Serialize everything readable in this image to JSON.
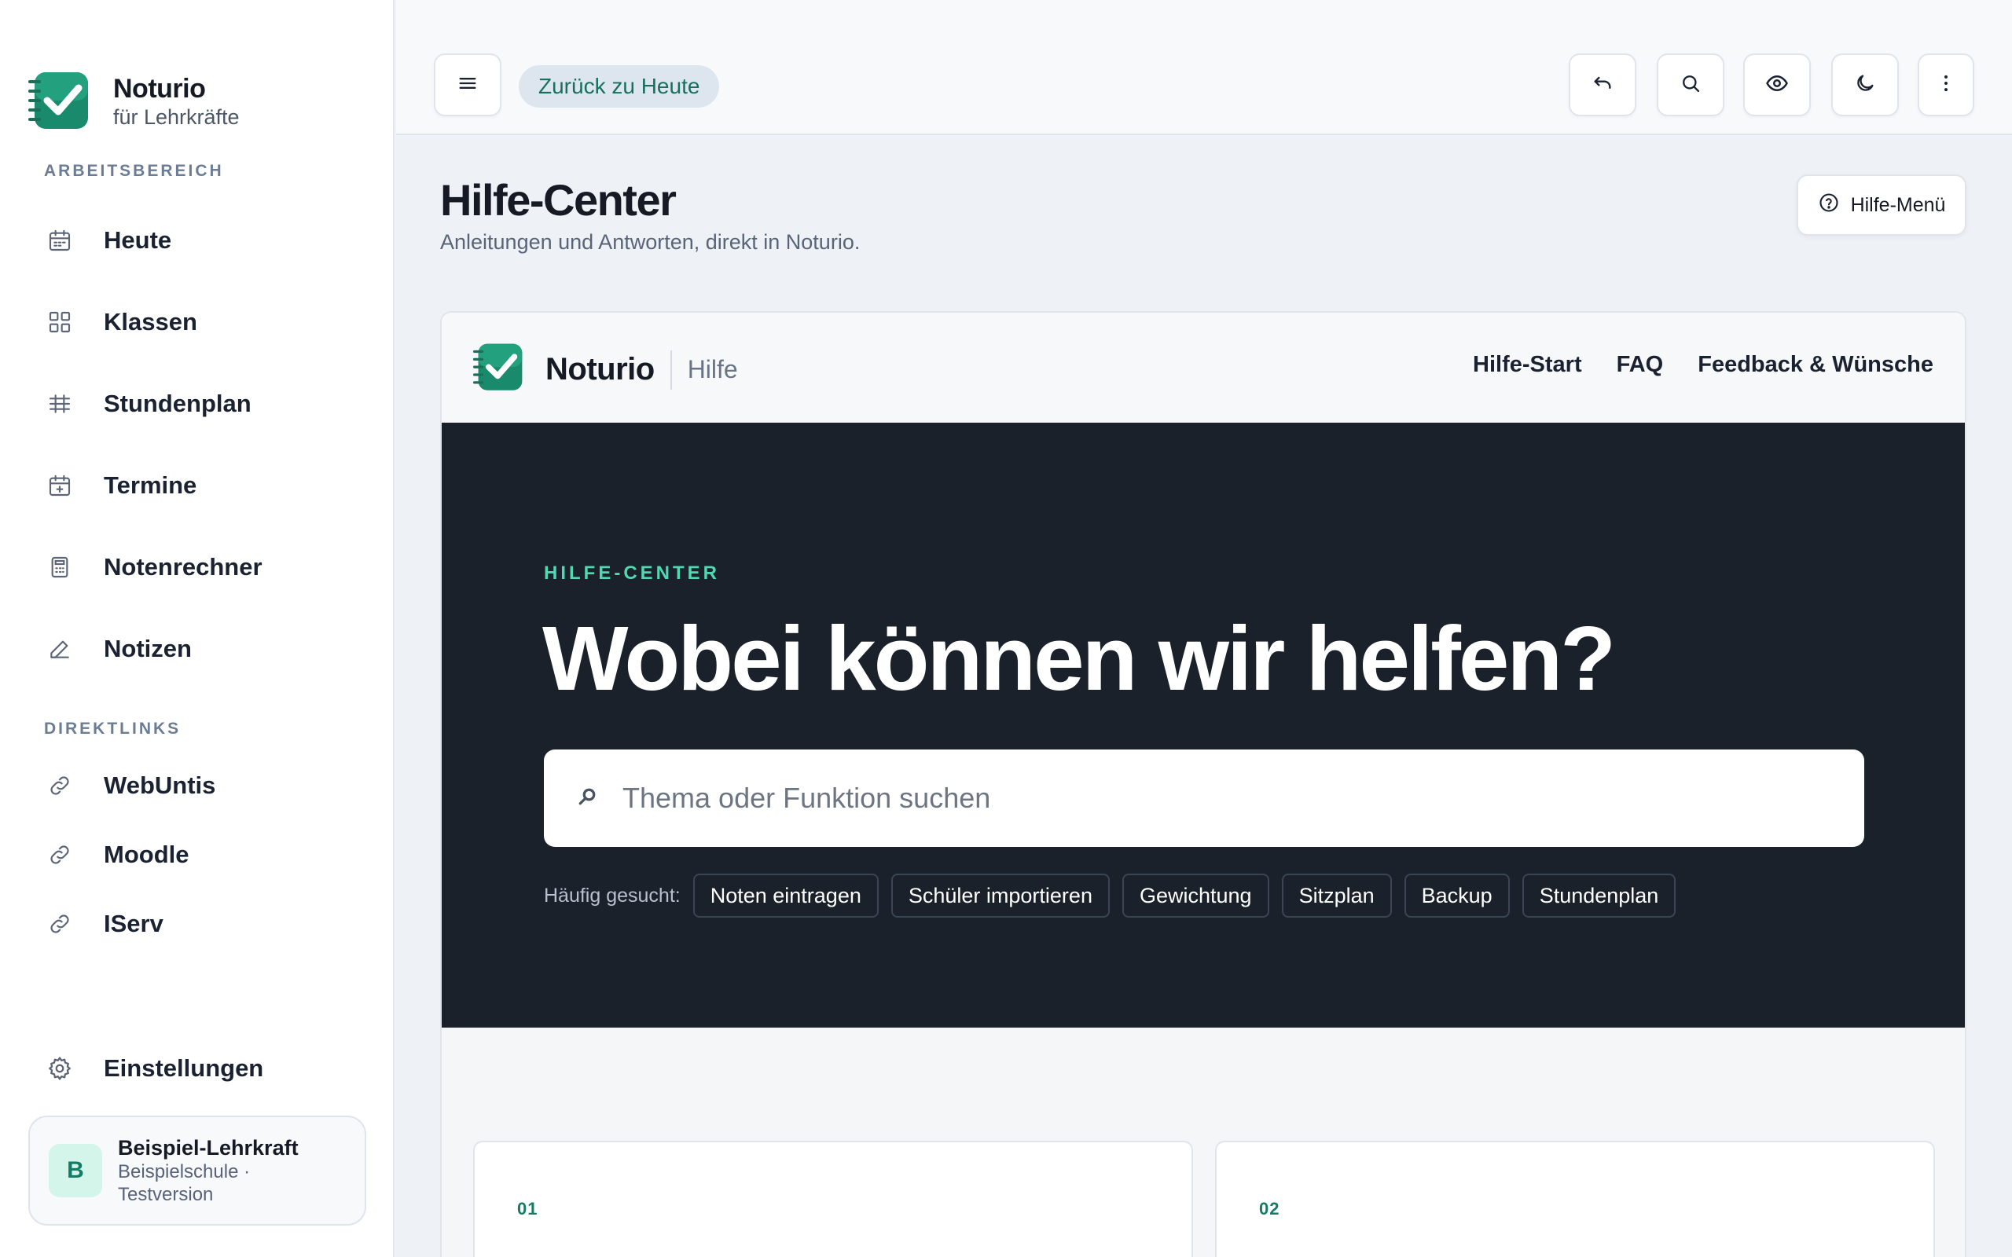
{
  "app": {
    "name": "Noturio",
    "subtitle": "für Lehrkräfte"
  },
  "sidebar": {
    "workspace_label": "ARBEITSBEREICH",
    "workspace_items": [
      {
        "label": "Heute",
        "icon": "calendar-icon"
      },
      {
        "label": "Klassen",
        "icon": "grid-icon"
      },
      {
        "label": "Stundenplan",
        "icon": "table-icon"
      },
      {
        "label": "Termine",
        "icon": "calendar-plus-icon"
      },
      {
        "label": "Notenrechner",
        "icon": "calculator-icon"
      },
      {
        "label": "Notizen",
        "icon": "pencil-icon"
      }
    ],
    "links_label": "DIREKTLINKS",
    "link_items": [
      {
        "label": "WebUntis",
        "icon": "link-icon"
      },
      {
        "label": "Moodle",
        "icon": "link-icon"
      },
      {
        "label": "IServ",
        "icon": "link-icon"
      }
    ],
    "settings_label": "Einstellungen",
    "user": {
      "initial": "B",
      "name": "Beispiel-Lehrkraft",
      "meta": "Beispielschule · Testversion"
    }
  },
  "topbar": {
    "back_label": "Zurück zu Heute",
    "icons": [
      "menu-icon",
      "undo-icon",
      "search-icon",
      "eye-icon",
      "moon-icon",
      "more-vertical-icon"
    ]
  },
  "page": {
    "title": "Hilfe-Center",
    "subtitle": "Anleitungen und Antworten, direkt in Noturio.",
    "help_menu_label": "Hilfe-Menü"
  },
  "help_frame": {
    "brand": "Noturio",
    "brand_sub": "Hilfe",
    "nav_links": [
      "Hilfe-Start",
      "FAQ",
      "Feedback & Wünsche"
    ],
    "hero": {
      "eyebrow": "HILFE-CENTER",
      "title": "Wobei können wir helfen?",
      "search_placeholder": "Thema oder Funktion suchen",
      "quick_label": "Häufig gesucht:",
      "chips": [
        "Noten eintragen",
        "Schüler importieren",
        "Gewichtung",
        "Sitzplan",
        "Backup",
        "Stundenplan"
      ]
    },
    "cards": [
      {
        "number": "01"
      },
      {
        "number": "02"
      }
    ]
  },
  "colors": {
    "accent": "#177a64",
    "hero_bg": "#1a212b",
    "eyebrow": "#52d7b2"
  }
}
